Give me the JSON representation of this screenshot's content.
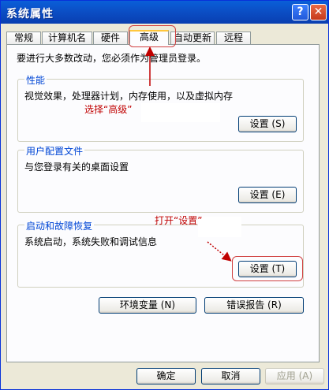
{
  "window": {
    "title": "系统属性",
    "help_label": "?",
    "close_label": "✕"
  },
  "tabs": [
    "常规",
    "计算机名",
    "硬件",
    "高级",
    "自动更新",
    "远程"
  ],
  "active_tab": "高级",
  "admin_note": "要进行大多数改动，您必须作为管理员登录。",
  "groups": {
    "performance": {
      "label": "性能",
      "desc": "视觉效果，处理器计划，内存使用，以及虚拟内存",
      "button": "设置 (S)"
    },
    "profiles": {
      "label": "用户配置文件",
      "desc": "与您登录有关的桌面设置",
      "button": "设置 (E)"
    },
    "startup": {
      "label": "启动和故障恢复",
      "desc": "系统启动，系统失败和调试信息",
      "button": "设置 (T)"
    }
  },
  "buttons": {
    "env": "环境变量 (N)",
    "error": "错误报告 (R)",
    "ok": "确定",
    "cancel": "取消",
    "apply": "应用 (A)"
  },
  "annotations": {
    "select_advanced": "选择“高级”",
    "open_settings": "打开“设置”"
  },
  "colors": {
    "annotation": "#c00000",
    "title_bar": "#0a5fd8",
    "group_label": "#0046d5"
  }
}
